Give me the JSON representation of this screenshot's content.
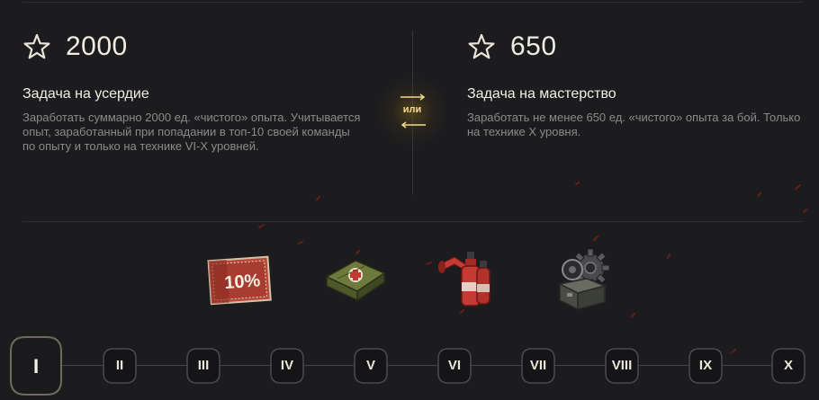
{
  "left_task": {
    "icon": "star-outline-icon",
    "value": "2000",
    "title": "Задача на усердие",
    "description": "Заработать суммарно 2000 ед. «чистого» опыта. Учитывается опыт, заработанный при попадании в топ-10 своей команды по опыту и только на технике VI-X уровней."
  },
  "right_task": {
    "icon": "star-outline-icon",
    "value": "650",
    "title": "Задача на мастерство",
    "description": "Заработать не менее 650 ед. «чистого» опыта за бой. Только на технике X уровня."
  },
  "or_badge": {
    "label": "или",
    "color": "#f3d98c"
  },
  "rewards": [
    {
      "icon": "ticket-10-percent-icon",
      "text": "10%"
    },
    {
      "icon": "first-aid-kit-icon"
    },
    {
      "icon": "fire-extinguisher-icon"
    },
    {
      "icon": "toolbox-gear-icon"
    }
  ],
  "levels": [
    "I",
    "II",
    "III",
    "IV",
    "V",
    "VI",
    "VII",
    "VIII",
    "IX",
    "X"
  ],
  "active_level": "I",
  "colors": {
    "background": "#1c1c1f",
    "text": "#e9e4d6",
    "muted": "#8b8a86",
    "accent": "#f3d98c"
  }
}
